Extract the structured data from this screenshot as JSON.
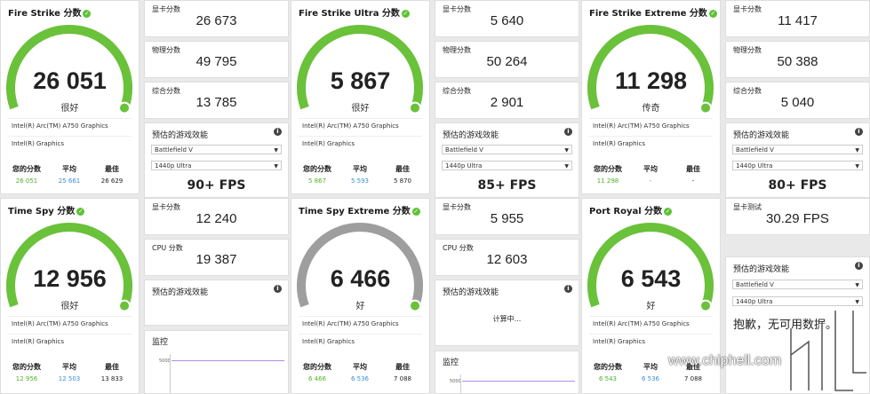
{
  "colors": {
    "green": "#6ac13a",
    "gray": "#9e9e9e",
    "avg_blue": "#3a8fd8"
  },
  "labels": {
    "your_score": "您的分数",
    "average": "平均",
    "best": "最佳",
    "graphics_score": "显卡分数",
    "physics_score": "物理分数",
    "combined_score": "综合分数",
    "cpu_score": "CPU 分数",
    "estimated_perf": "预估的游戏效能",
    "monitor": "监控",
    "graphics_test": "显卡测试",
    "calculating": "计算中...",
    "sorry_text": "抱歉，无可用数据。",
    "gpu_line": "Intel(R) Arc(TM) A750 Graphics",
    "gpu_line2": "Intel(R) Graphics",
    "game": "Battlefield V",
    "resolution": "1440p Ultra",
    "axis_tick": "5000"
  },
  "tests": [
    {
      "title": "Fire Strike 分数",
      "score": "26 051",
      "rating": "很好",
      "level": 1.0,
      "gauge": "green",
      "you": "26 051",
      "avg": "25 661",
      "best": "26 629",
      "sub": [
        {
          "label": "显卡分数",
          "value": "26 673"
        },
        {
          "label": "物理分数",
          "value": "49 795"
        },
        {
          "label": "综合分数",
          "value": "13 785"
        }
      ],
      "fps": "90+ FPS"
    },
    {
      "title": "Fire Strike Ultra 分数",
      "score": "5 867",
      "rating": "很好",
      "level": 1.0,
      "gauge": "green",
      "you": "5 867",
      "avg": "5 593",
      "best": "5 870",
      "sub": [
        {
          "label": "显卡分数",
          "value": "5 640"
        },
        {
          "label": "物理分数",
          "value": "50 264"
        },
        {
          "label": "综合分数",
          "value": "2 901"
        }
      ],
      "fps": "85+ FPS"
    },
    {
      "title": "Fire Strike Extreme 分数",
      "score": "11 298",
      "rating": "传奇",
      "level": 1.0,
      "gauge": "green",
      "you": "11 298",
      "avg": "-",
      "best": "-",
      "sub": [
        {
          "label": "显卡分数",
          "value": "11 417"
        },
        {
          "label": "物理分数",
          "value": "50 388"
        },
        {
          "label": "综合分数",
          "value": "5 040"
        }
      ],
      "fps": "80+ FPS"
    },
    {
      "title": "Time Spy 分数",
      "score": "12 956",
      "rating": "很好",
      "level": 1.0,
      "gauge": "green",
      "you": "12 956",
      "avg": "12 503",
      "best": "13 833",
      "sub": [
        {
          "label": "显卡分数",
          "value": "12 240"
        },
        {
          "label": "CPU 分数",
          "value": "19 387"
        }
      ]
    },
    {
      "title": "Time Spy Extreme 分数",
      "score": "6 466",
      "rating": "好",
      "level": 1.0,
      "gauge": "gray",
      "you": "6 466",
      "avg": "6 536",
      "best": "7 088",
      "sub": [
        {
          "label": "显卡分数",
          "value": "5 955"
        },
        {
          "label": "CPU 分数",
          "value": "12 603"
        }
      ]
    },
    {
      "title": "Port Royal 分数",
      "score": "6 543",
      "rating": "好",
      "level": 1.0,
      "gauge": "green",
      "you": "6 543",
      "avg": "6 536",
      "best": "7 088",
      "sub": [
        {
          "label": "显卡测试",
          "value": "30.29 FPS"
        }
      ]
    }
  ],
  "watermark": "www.chiphell.com"
}
